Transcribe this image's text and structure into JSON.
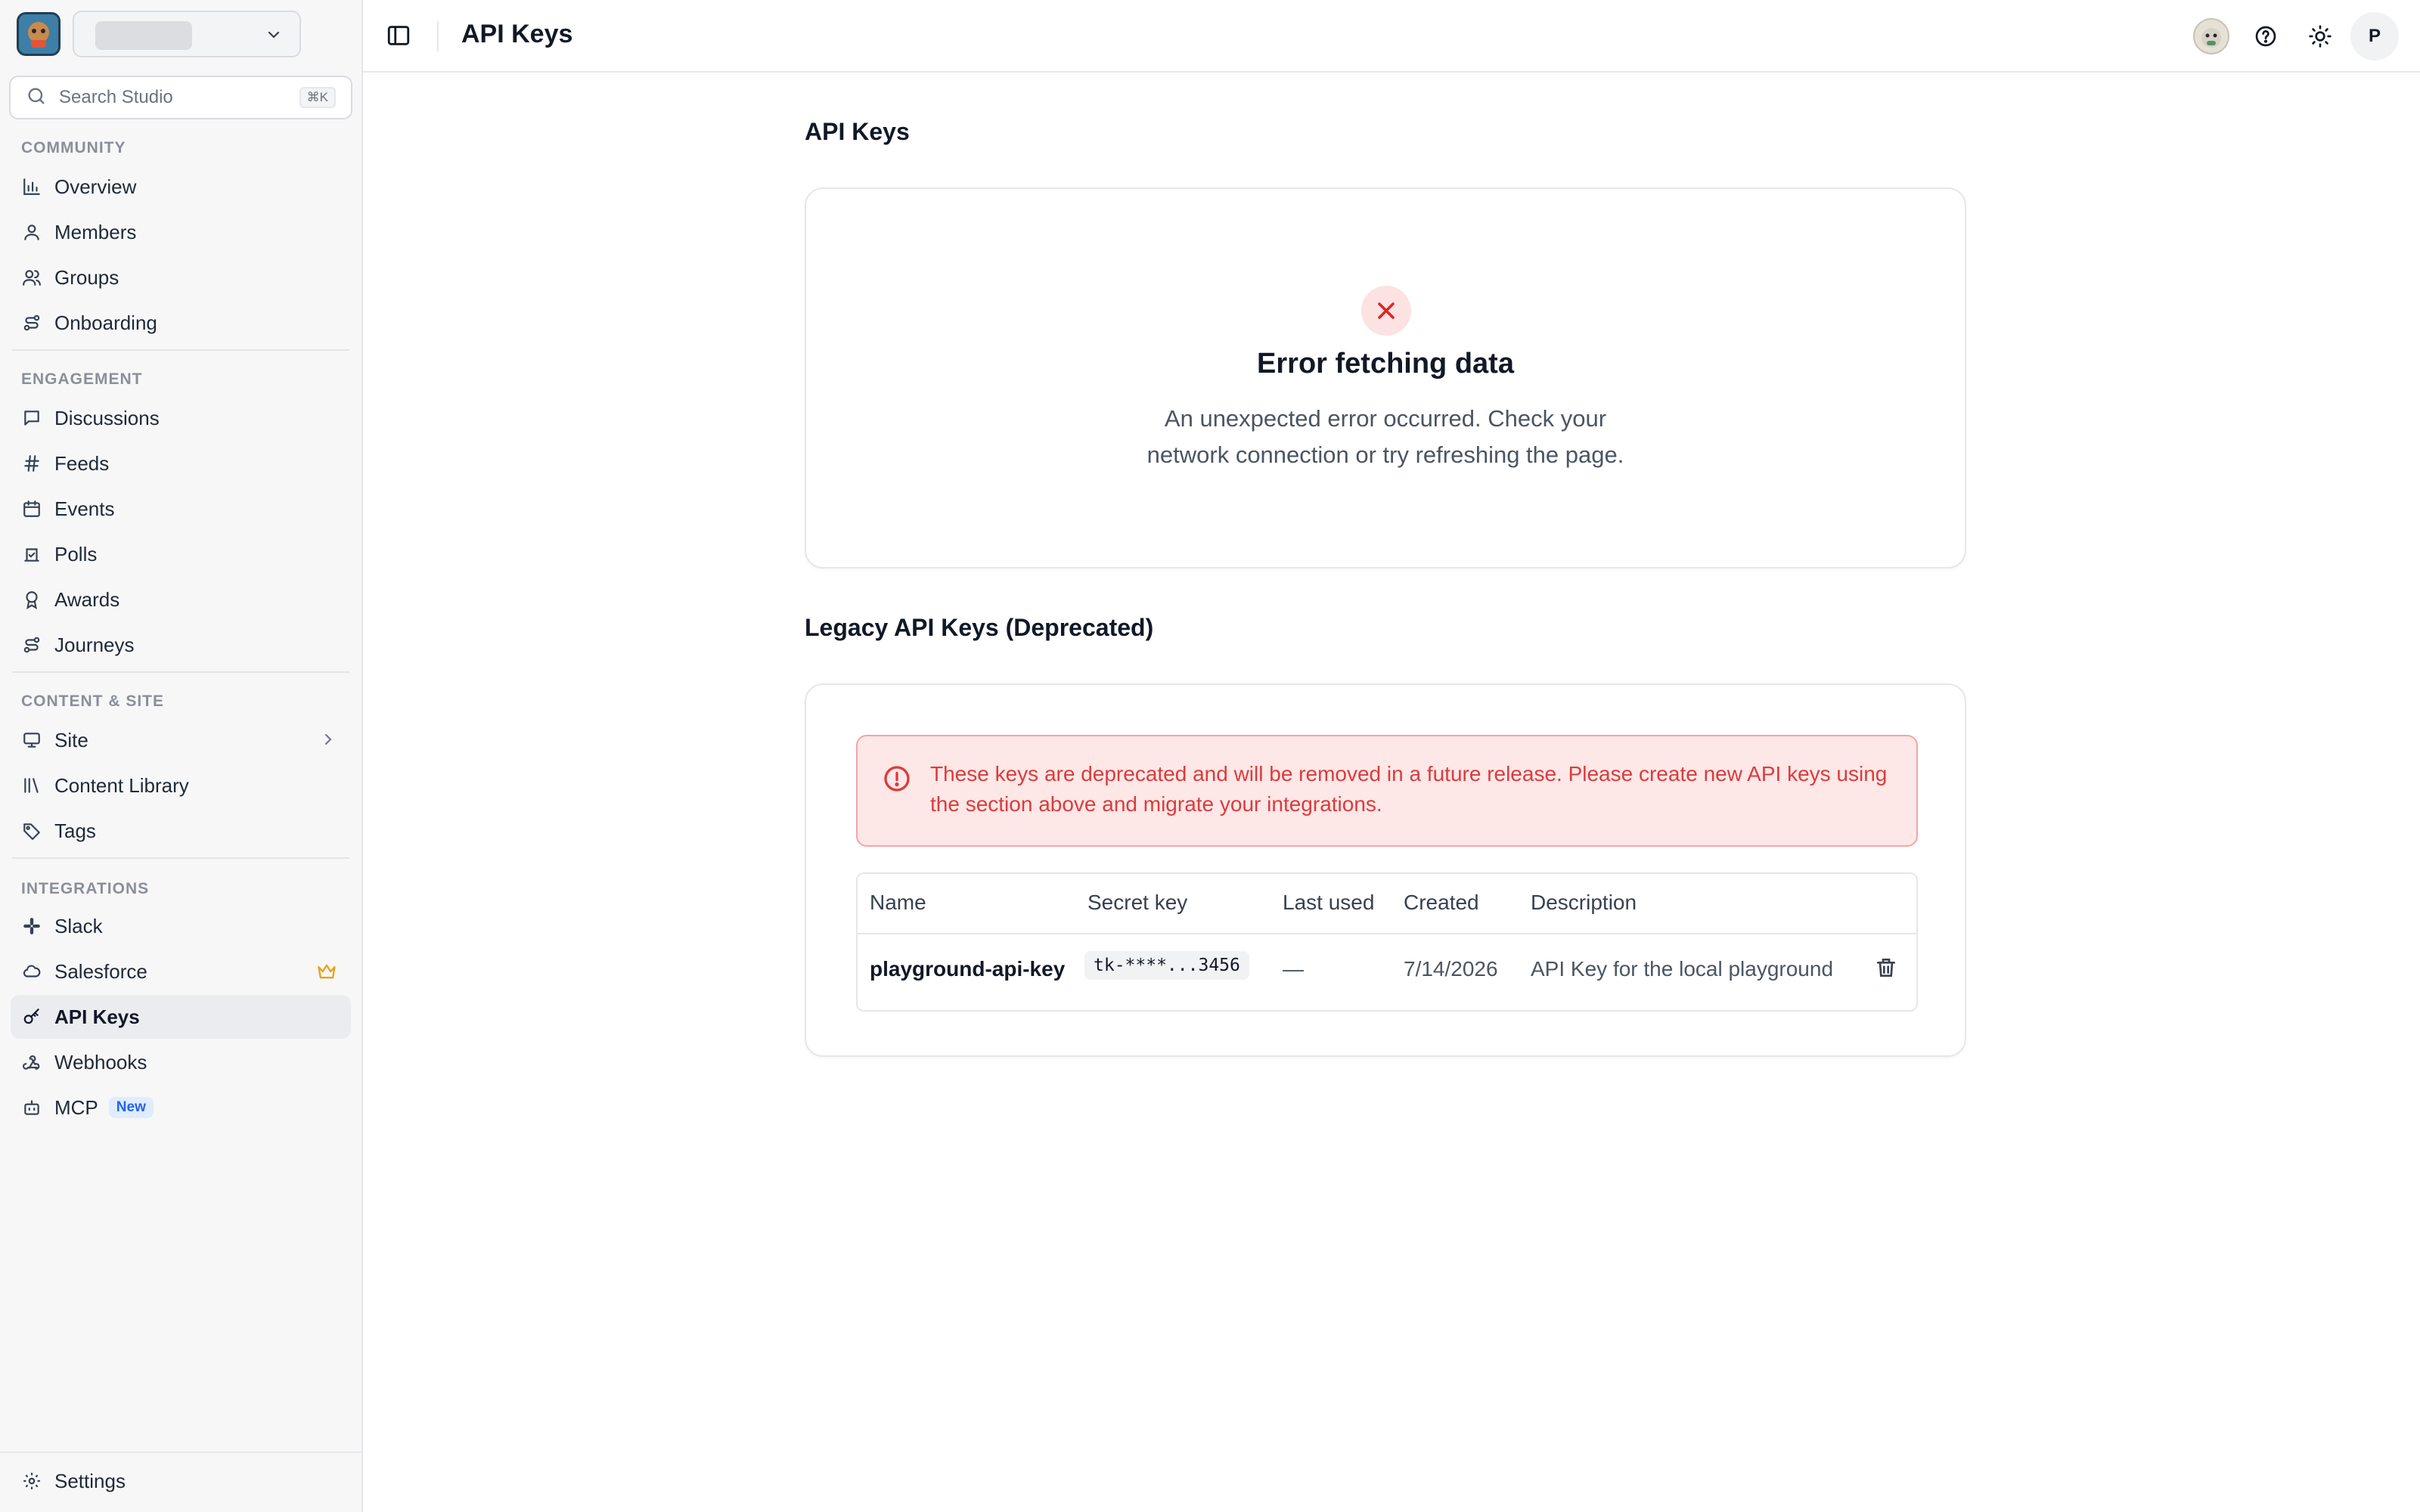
{
  "sidebar": {
    "search": {
      "placeholder": "Search Studio",
      "shortcut": "⌘K"
    },
    "sections": {
      "community": "COMMUNITY",
      "engagement": "ENGAGEMENT",
      "content": "CONTENT & SITE",
      "integrations": "INTEGRATIONS"
    },
    "items": {
      "overview": "Overview",
      "members": "Members",
      "groups": "Groups",
      "onboarding": "Onboarding",
      "discussions": "Discussions",
      "feeds": "Feeds",
      "events": "Events",
      "polls": "Polls",
      "awards": "Awards",
      "journeys": "Journeys",
      "site": "Site",
      "content_library": "Content Library",
      "tags": "Tags",
      "slack": "Slack",
      "salesforce": "Salesforce",
      "api_keys": "API Keys",
      "webhooks": "Webhooks",
      "mcp": "MCP",
      "mcp_badge": "New",
      "settings": "Settings"
    },
    "active_item": "API Keys"
  },
  "topbar": {
    "title": "API Keys",
    "user_initial": "P"
  },
  "main": {
    "api_keys_heading": "API Keys",
    "error": {
      "title": "Error fetching data",
      "message_line1": "An unexpected error occurred. Check your",
      "message_line2": "network connection or try refreshing the page."
    },
    "legacy_heading": "Legacy API Keys (Deprecated)",
    "alert_text": "These keys are deprecated and will be removed in a future release. Please create new API keys using the section above and migrate your integrations.",
    "table": {
      "headers": [
        "Name",
        "Secret key",
        "Last used",
        "Created",
        "Description"
      ],
      "rows": [
        {
          "name": "playground-api-key",
          "secret": "tk-****...3456",
          "last_used": "—",
          "created": "7/14/2026",
          "description": "API Key for the local playground"
        }
      ]
    }
  },
  "colors": {
    "accent_error": "#dc3b3b",
    "alert_bg": "#fde7e7",
    "badge_blue": "#2563eb",
    "crown": "#e8a317"
  },
  "icons": [
    "chevron-down-icon",
    "search-icon",
    "chart-icon",
    "user-icon",
    "users-icon",
    "route-icon",
    "message-icon",
    "hash-icon",
    "calendar-icon",
    "poll-icon",
    "award-icon",
    "journey-icon",
    "monitor-icon",
    "chevron-right-icon",
    "library-icon",
    "tag-icon",
    "slack-icon",
    "cloud-icon",
    "crown-icon",
    "key-icon",
    "webhook-icon",
    "bot-icon",
    "gear-icon",
    "sidebar-toggle-icon",
    "help-icon",
    "sun-icon",
    "x-icon",
    "alert-circle-icon",
    "trash-icon"
  ]
}
